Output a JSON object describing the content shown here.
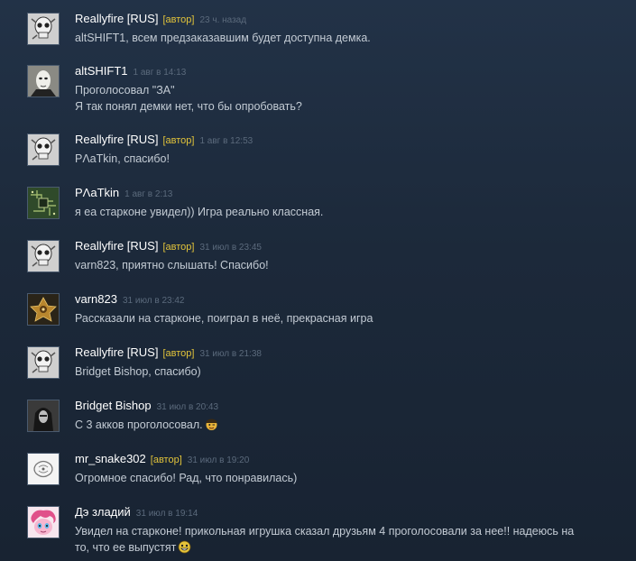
{
  "comments": [
    {
      "author": "Reallyfire [RUS]",
      "badge": "[автор]",
      "timestamp": "23 ч. назад",
      "text": "altSHIFT1, всем предзаказавшим будет доступна демка.",
      "avatar": "skull-avatar"
    },
    {
      "author": "altSHIFT1",
      "badge": "",
      "timestamp": "1 авг в 14:13",
      "text": "Проголосовал \"ЗА\"\nЯ так понял демки нет, что бы опробовать?",
      "avatar": "mask-avatar"
    },
    {
      "author": "Reallyfire [RUS]",
      "badge": "[автор]",
      "timestamp": "1 авг в 12:53",
      "text": "PΛaTkin, спасибо!",
      "avatar": "skull-avatar"
    },
    {
      "author": "PΛaTkin",
      "badge": "",
      "timestamp": "1 авг в 2:13",
      "text": "я еа старконе увидел)) Игра реально классная.",
      "avatar": "circuit-avatar"
    },
    {
      "author": "Reallyfire [RUS]",
      "badge": "[автор]",
      "timestamp": "31 июл в 23:45",
      "text": "varn823, приятно слышать! Спасибо!",
      "avatar": "skull-avatar"
    },
    {
      "author": "varn823",
      "badge": "",
      "timestamp": "31 июл в 23:42",
      "text": "Рассказали на старконе, поиграл в неё, прекрасная игра",
      "avatar": "emblem-avatar"
    },
    {
      "author": "Reallyfire [RUS]",
      "badge": "[автор]",
      "timestamp": "31 июл в 21:38",
      "text": "Bridget Bishop, спасибо)",
      "avatar": "skull-avatar"
    },
    {
      "author": "Bridget Bishop",
      "badge": "",
      "timestamp": "31 июл в 20:43",
      "text": "С 3 акков проголосовал.",
      "avatar": "hooded-avatar",
      "emote": "winking-face-emote"
    },
    {
      "author": "mr_snake302",
      "badge": "[автор]",
      "timestamp": "31 июл в 19:20",
      "text": "Огромное спасибо! Рад, что понравилась)",
      "avatar": "logo-avatar"
    },
    {
      "author": "Дэ зладий",
      "badge": "",
      "timestamp": "31 июл в 19:14",
      "text": "Увидел на старконе! прикольная игрушка сказал друзьям 4 проголосовали за нее!! надеюсь на\nто, что ее выпустят",
      "avatar": "pony-avatar",
      "emote": "grinning-face-emote"
    }
  ],
  "colors": {
    "background": "#1c293a",
    "author": "#ffffff",
    "badge": "#e1c33a",
    "timestamp": "#5b6a7c",
    "text": "#c3cbd4"
  }
}
